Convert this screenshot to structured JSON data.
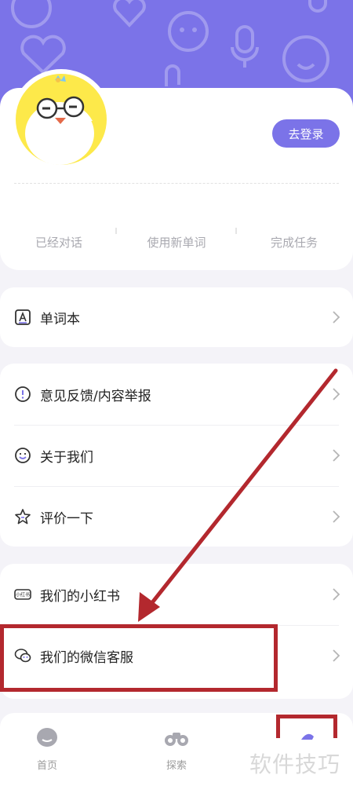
{
  "profile": {
    "login_button": "去登录",
    "stats": [
      "已经对话",
      "使用新单词",
      "完成任务"
    ]
  },
  "menu": {
    "wordbook": "单词本",
    "feedback": "意见反馈/内容举报",
    "about": "关于我们",
    "rate": "评价一下",
    "xiaohongshu": "我们的小红书",
    "wechat_service": "我们的微信客服"
  },
  "tabs": {
    "home": "首页",
    "explore": "探索"
  },
  "xhs_icon_text": "小红书",
  "watermark": "软件技巧",
  "colors": {
    "accent": "#7b73e8",
    "annotation": "#b3282e"
  }
}
